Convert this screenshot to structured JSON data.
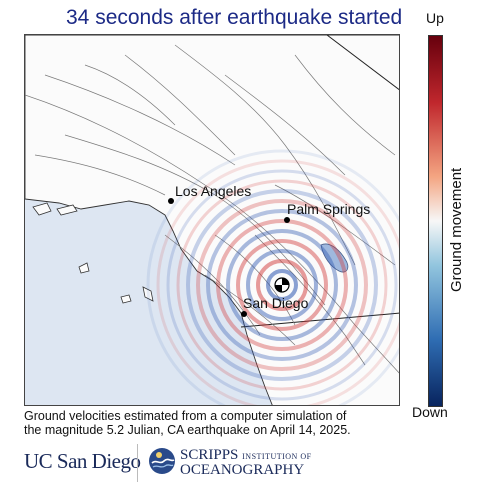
{
  "title": "34 seconds after earthquake started",
  "map": {
    "cities": [
      {
        "name": "Los Angeles"
      },
      {
        "name": "Palm Springs"
      },
      {
        "name": "San Diego"
      }
    ]
  },
  "colorbar": {
    "top_label": "Up",
    "bottom_label": "Down",
    "axis_label": "Ground movement",
    "colors": [
      "#67000d",
      "#c0272d",
      "#f4a582",
      "#f7f7f7",
      "#92c5de",
      "#2f6db3",
      "#08245e"
    ]
  },
  "caption": {
    "line1": "Ground velocities estimated from a computer simulation of",
    "line2": "the magnitude 5.2 Julian, CA earthquake on April 14, 2025."
  },
  "logos": {
    "ucsd": "UC San Diego",
    "sio_line1_big": "SCRIPPS",
    "sio_line1_small": "INSTITUTION OF",
    "sio_line2": "OCEANOGRAPHY"
  }
}
